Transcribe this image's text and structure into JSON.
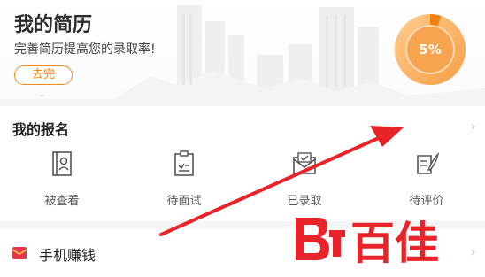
{
  "resume": {
    "title": "我的简历",
    "subtitle": "完善简历提高您的录取率!",
    "button_label": "去完",
    "progress_text": "5%",
    "progress_value": 0.05,
    "accent_color": "#f28a1c"
  },
  "signup": {
    "title": "我的报名",
    "items": [
      {
        "label": "被查看",
        "icon": "profile-book-icon"
      },
      {
        "label": "待面试",
        "icon": "clipboard-icon"
      },
      {
        "label": "已录取",
        "icon": "envelope-icon"
      },
      {
        "label": "待评价",
        "icon": "feather-scroll-icon"
      }
    ]
  },
  "earn": {
    "label": "手机赚钱",
    "icon": "red-envelope-icon"
  },
  "watermark": {
    "text": "百佳"
  },
  "annotation": {
    "arrow_color": "#e8242a"
  }
}
